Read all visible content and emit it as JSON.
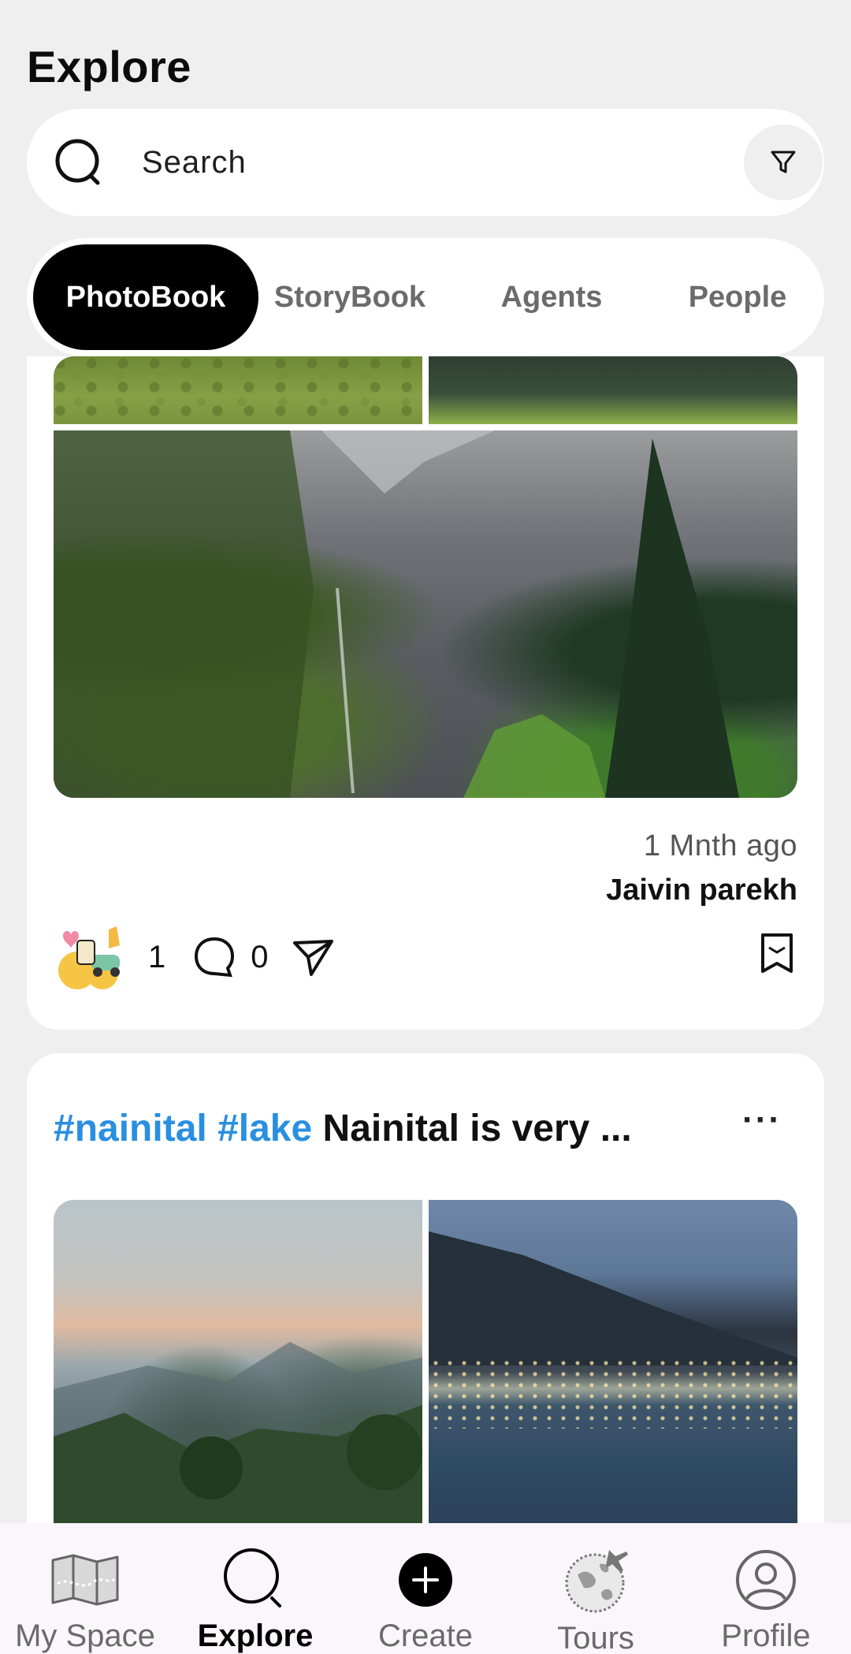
{
  "header": {
    "title": "Explore"
  },
  "search": {
    "placeholder": "Search"
  },
  "tabs": [
    {
      "label": "PhotoBook",
      "active": true
    },
    {
      "label": "StoryBook",
      "active": false
    },
    {
      "label": "Agents",
      "active": false
    },
    {
      "label": "People",
      "active": false
    }
  ],
  "posts": [
    {
      "time_ago": "1 Mnth ago",
      "author": "Jaivin parekh",
      "reaction_count": "1",
      "comment_count": "0"
    },
    {
      "hashtags": [
        "#nainital",
        "#lake"
      ],
      "caption_text": "Nainital is very ...",
      "more": "···"
    }
  ],
  "bottom_nav": [
    {
      "label": "My Space",
      "icon": "map-icon",
      "active": false
    },
    {
      "label": "Explore",
      "icon": "search-icon",
      "active": true
    },
    {
      "label": "Create",
      "icon": "plus-circle-icon",
      "active": false
    },
    {
      "label": "Tours",
      "icon": "globe-plane-icon",
      "active": false
    },
    {
      "label": "Profile",
      "icon": "profile-icon",
      "active": false
    }
  ],
  "colors": {
    "hashtag": "#2a8fe0",
    "active_tab_bg": "#000000",
    "page_bg": "#efeff0"
  }
}
